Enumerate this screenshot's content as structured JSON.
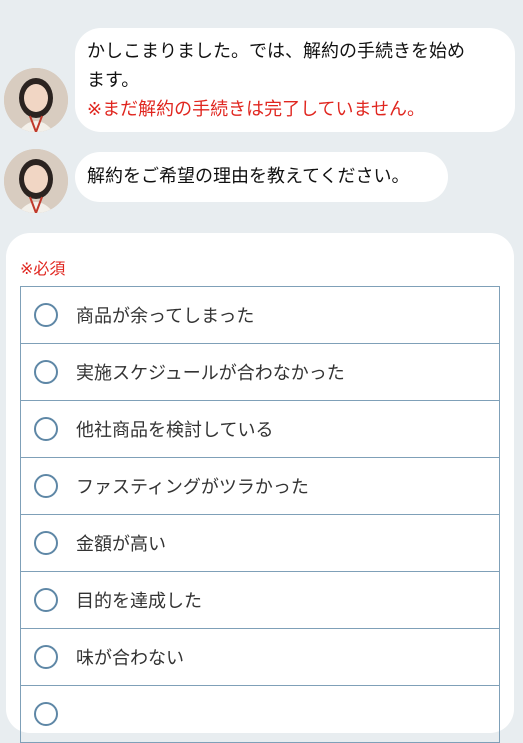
{
  "messages": [
    {
      "avatar": "operator-avatar",
      "lines": [
        "かしこまりました。では、解約の手続きを始め",
        "ます。"
      ],
      "warning": "※まだ解約の手続きは完了していません。"
    },
    {
      "avatar": "operator-avatar",
      "lines": [
        "解約をご希望の理由を教えてください。"
      ]
    }
  ],
  "form": {
    "required_label": "※必須",
    "options": [
      "商品が余ってしまった",
      "実施スケジュールが合わなかった",
      "他社商品を検討している",
      "ファスティングがツラかった",
      "金額が高い",
      "目的を達成した",
      "味が合わない",
      ""
    ]
  },
  "colors": {
    "background": "#e8edf0",
    "warning": "#e0261f",
    "radio_border": "#5e87a6",
    "option_border": "#7fa0b8"
  }
}
